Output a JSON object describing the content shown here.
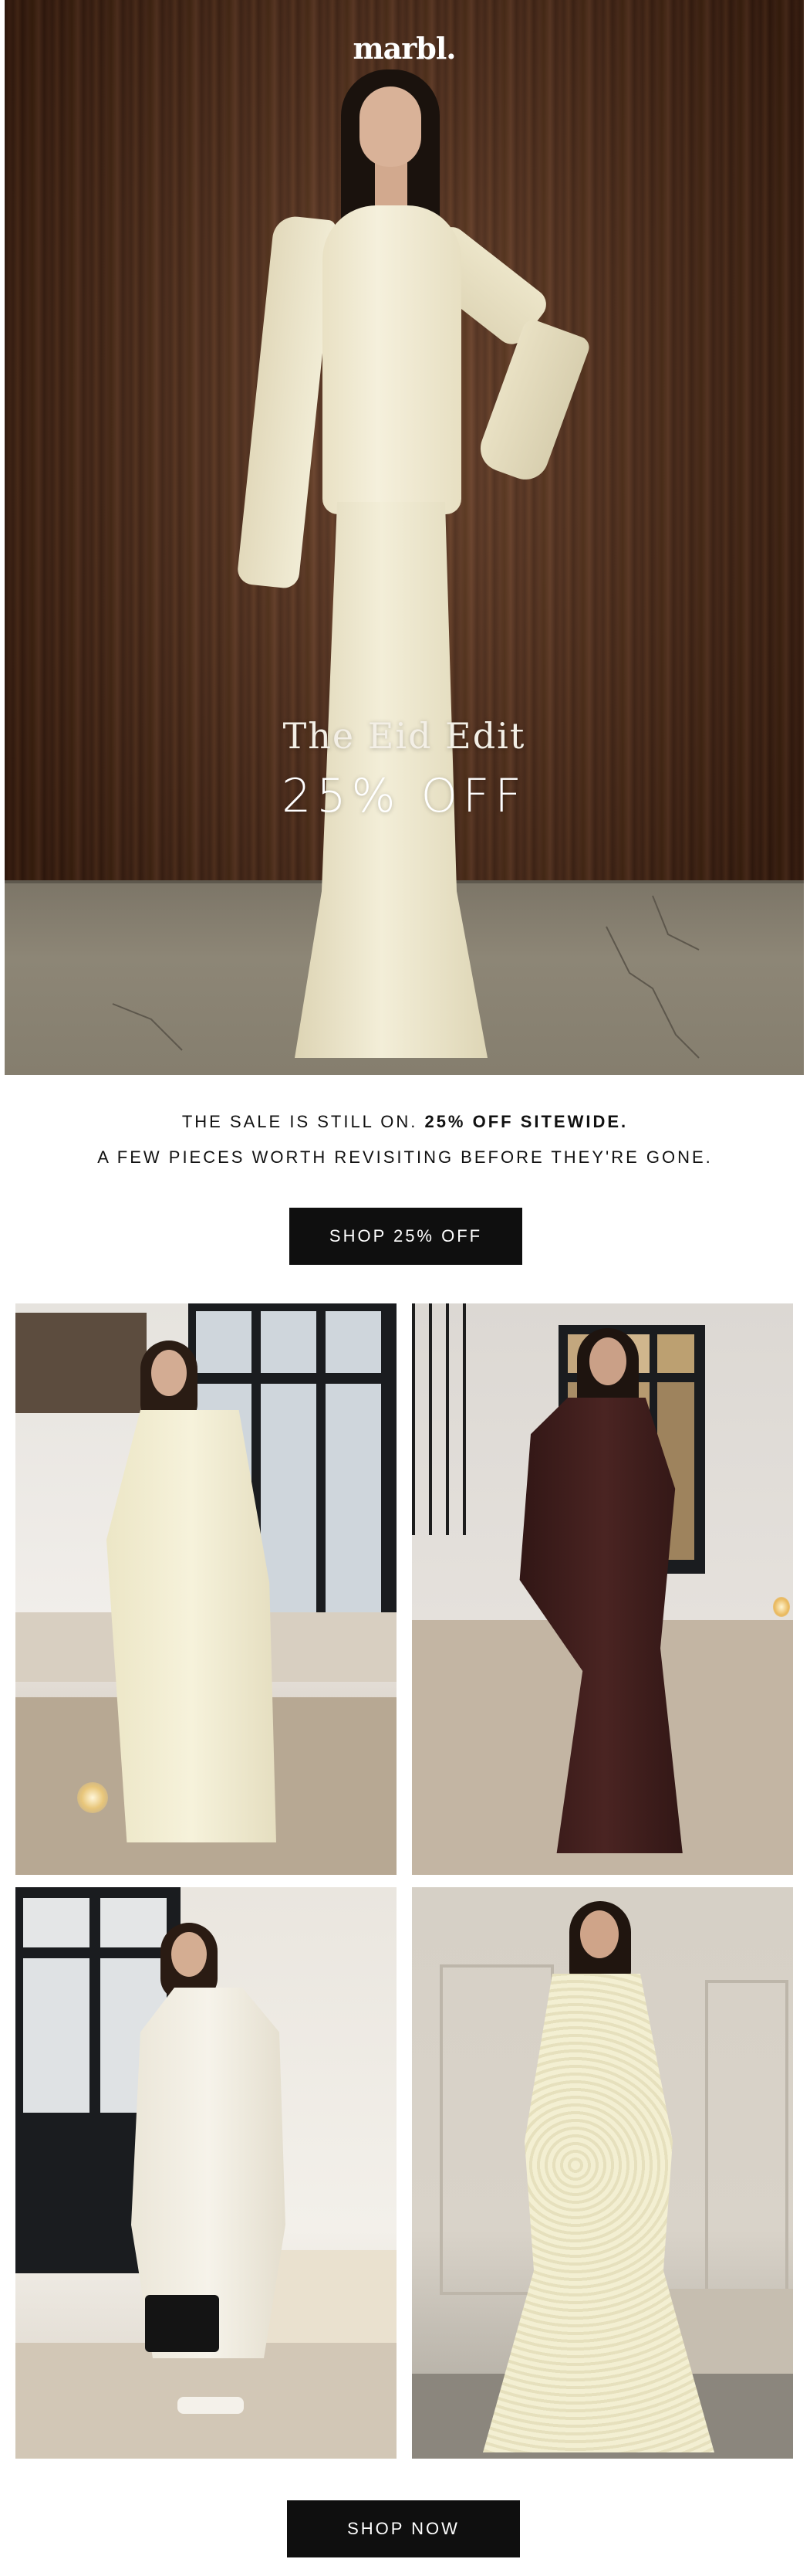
{
  "brand": {
    "logo": "marbl."
  },
  "hero": {
    "subtitle": "The Eid Edit",
    "offer": "25% OFF"
  },
  "intro": {
    "line1_prefix": "THE SALE IS STILL ON. ",
    "line1_bold": "25% OFF SITEWIDE.",
    "line2": "A FEW PIECES WORTH REVISITING BEFORE THEY'RE GONE."
  },
  "cta_primary": {
    "label": "SHOP 25% OFF"
  },
  "cta_secondary": {
    "label": "SHOP NOW"
  },
  "colors": {
    "button_bg": "#0f0f0f",
    "button_text": "#ffffff",
    "hero_wood": "#4a2817",
    "cream_dress": "#f1ecd5",
    "brown_dress": "#3a1b1a"
  }
}
